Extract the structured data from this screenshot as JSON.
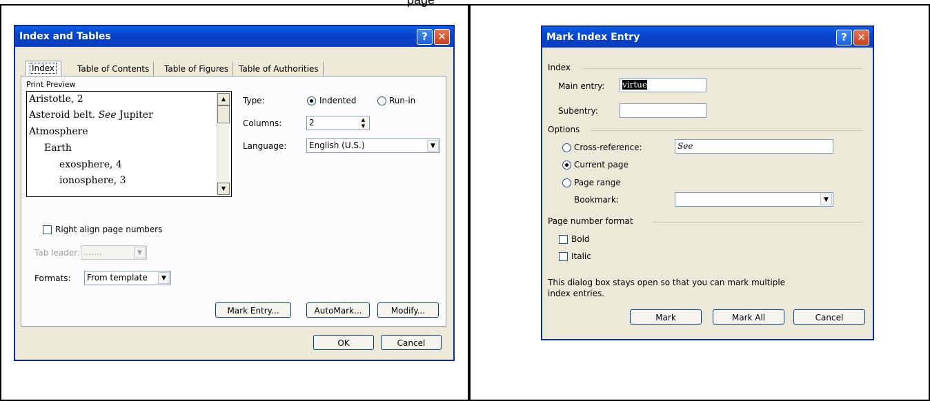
{
  "cropped_text": "page",
  "left_dialog": {
    "title": "Index and Tables",
    "tabs": [
      "Index",
      "Table of Contents",
      "Table of Figures",
      "Table of Authorities"
    ],
    "print_preview_label": "Print Preview",
    "preview_lines": [
      {
        "text": "Aristotle, 2"
      },
      {
        "text": "Asteroid belt. ",
        "italic": "See",
        "rest": " Jupiter"
      },
      {
        "text": "Atmosphere"
      },
      {
        "text": "Earth"
      },
      {
        "text": "exosphere, 4"
      },
      {
        "text": "ionosphere, 3"
      }
    ],
    "type_label": "Type:",
    "type_indented": "Indented",
    "type_runin": "Run-in",
    "columns_label": "Columns:",
    "columns_value": "2",
    "language_label": "Language:",
    "language_value": "English (U.S.)",
    "right_align_label": "Right align page numbers",
    "tab_leader_label": "Tab leader:",
    "tab_leader_value": ".......",
    "formats_label": "Formats:",
    "formats_value": "From template",
    "mark_entry_button": "Mark Entry...",
    "automark_button": "AutoMark...",
    "modify_button": "Modify...",
    "ok_button": "OK",
    "cancel_button": "Cancel"
  },
  "right_dialog": {
    "title": "Mark Index Entry",
    "index_group": "Index",
    "main_entry_label": "Main entry:",
    "main_entry_value": "virtue",
    "subentry_label": "Subentry:",
    "subentry_value": "",
    "options_group": "Options",
    "cross_reference_label": "Cross-reference:",
    "cross_reference_value": "See",
    "current_page_label": "Current page",
    "page_range_label": "Page range",
    "bookmark_label": "Bookmark:",
    "bookmark_value": "",
    "page_number_format_group": "Page number format",
    "bold_label": "Bold",
    "italic_label": "Italic",
    "note_line1": "This dialog box stays open so that you can mark multiple",
    "note_line2": "index entries.",
    "mark_button": "Mark",
    "mark_all_button": "Mark All",
    "cancel_button": "Cancel"
  },
  "colors": {
    "titlebar": "#0842c8",
    "dialog_bg": "#ece9d8",
    "close_button": "#c9401d"
  },
  "icons": [
    "help-icon",
    "close-icon",
    "scroll-up-icon",
    "scroll-down-icon",
    "dropdown-arrow-icon",
    "spin-up-icon",
    "spin-down-icon"
  ]
}
